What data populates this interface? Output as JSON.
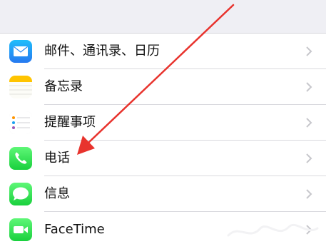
{
  "settings": {
    "rows": [
      {
        "label": "邮件、通讯录、日历",
        "icon": "mail-icon",
        "icon_color": "#2d9cf6"
      },
      {
        "label": "备忘录",
        "icon": "notes-icon",
        "icon_color": "#ffcc02"
      },
      {
        "label": "提醒事项",
        "icon": "reminders-icon",
        "icon_color": "#ffffff"
      },
      {
        "label": "电话",
        "icon": "phone-icon",
        "icon_color": "#4cd964"
      },
      {
        "label": "信息",
        "icon": "messages-icon",
        "icon_color": "#4cd964"
      },
      {
        "label": "FaceTime",
        "icon": "facetime-icon",
        "icon_color": "#4cd964"
      }
    ]
  },
  "colors": {
    "background": "#efeff4",
    "separator": "#d9d9de",
    "chevron": "#c7c7cc",
    "annotation_arrow": "#e8332d"
  },
  "annotation": {
    "points_to": "电话"
  }
}
